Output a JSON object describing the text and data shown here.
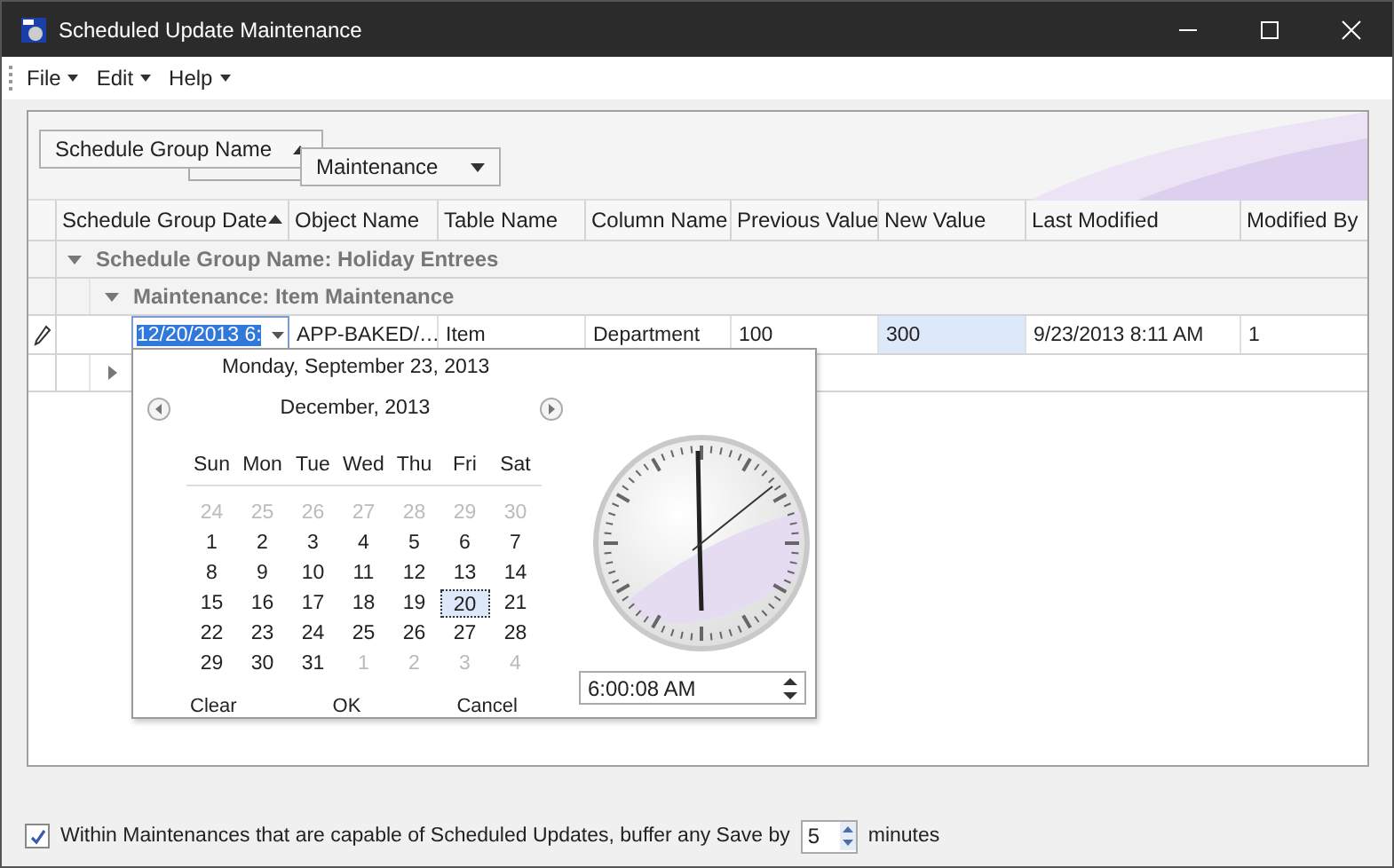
{
  "window": {
    "title": "Scheduled Update Maintenance"
  },
  "menu": [
    {
      "label": "File"
    },
    {
      "label": "Edit"
    },
    {
      "label": "Help"
    }
  ],
  "group_panel": [
    {
      "label": "Schedule Group Name",
      "ascending": true
    },
    {
      "label": "Maintenance",
      "ascending": false
    }
  ],
  "columns": [
    {
      "label": "Schedule Group Date",
      "sorted": true
    },
    {
      "label": "Object Name",
      "sorted": false
    },
    {
      "label": "Table Name",
      "sorted": false
    },
    {
      "label": "Column Name",
      "sorted": false
    },
    {
      "label": "Previous Value",
      "sorted": false
    },
    {
      "label": "New Value",
      "sorted": false
    },
    {
      "label": "Last Modified",
      "sorted": false
    },
    {
      "label": "Modified By",
      "sorted": false
    }
  ],
  "rows": [
    {
      "kind": "group",
      "text": "Schedule Group Name: Holiday Entrees",
      "expanded": true
    },
    {
      "kind": "subgroup",
      "text": "Maintenance: Item Maintenance",
      "expanded": true
    },
    {
      "kind": "data",
      "editing": true,
      "cells": [
        {
          "text": "12/20/2013 6:",
          "selected": false
        },
        {
          "text": "APP-BAKED/…",
          "selected": false
        },
        {
          "text": "Item",
          "selected": false
        },
        {
          "text": "Department",
          "selected": false
        },
        {
          "text": "100",
          "selected": false
        },
        {
          "text": "300",
          "selected": true
        },
        {
          "text": "9/23/2013 8:11 AM",
          "selected": false
        },
        {
          "text": "1",
          "selected": false
        }
      ]
    },
    {
      "kind": "subgroup_collapsed",
      "text": "",
      "expanded": false
    }
  ],
  "calendar": {
    "today": "Monday, September 23, 2013",
    "month": "December, 2013",
    "weekdays": [
      "Sun",
      "Mon",
      "Tue",
      "Wed",
      "Thu",
      "Fri",
      "Sat"
    ],
    "weeks": [
      [
        {
          "text": "24",
          "other_month": true,
          "selected": false
        },
        {
          "text": "25",
          "other_month": true,
          "selected": false
        },
        {
          "text": "26",
          "other_month": true,
          "selected": false
        },
        {
          "text": "27",
          "other_month": true,
          "selected": false
        },
        {
          "text": "28",
          "other_month": true,
          "selected": false
        },
        {
          "text": "29",
          "other_month": true,
          "selected": false
        },
        {
          "text": "30",
          "other_month": true,
          "selected": false
        }
      ],
      [
        {
          "text": "1",
          "other_month": false,
          "selected": false
        },
        {
          "text": "2",
          "other_month": false,
          "selected": false
        },
        {
          "text": "3",
          "other_month": false,
          "selected": false
        },
        {
          "text": "4",
          "other_month": false,
          "selected": false
        },
        {
          "text": "5",
          "other_month": false,
          "selected": false
        },
        {
          "text": "6",
          "other_month": false,
          "selected": false
        },
        {
          "text": "7",
          "other_month": false,
          "selected": false
        }
      ],
      [
        {
          "text": "8",
          "other_month": false,
          "selected": false
        },
        {
          "text": "9",
          "other_month": false,
          "selected": false
        },
        {
          "text": "10",
          "other_month": false,
          "selected": false
        },
        {
          "text": "11",
          "other_month": false,
          "selected": false
        },
        {
          "text": "12",
          "other_month": false,
          "selected": false
        },
        {
          "text": "13",
          "other_month": false,
          "selected": false
        },
        {
          "text": "14",
          "other_month": false,
          "selected": false
        }
      ],
      [
        {
          "text": "15",
          "other_month": false,
          "selected": false
        },
        {
          "text": "16",
          "other_month": false,
          "selected": false
        },
        {
          "text": "17",
          "other_month": false,
          "selected": false
        },
        {
          "text": "18",
          "other_month": false,
          "selected": false
        },
        {
          "text": "19",
          "other_month": false,
          "selected": false
        },
        {
          "text": "20",
          "other_month": false,
          "selected": true
        },
        {
          "text": "21",
          "other_month": false,
          "selected": false
        }
      ],
      [
        {
          "text": "22",
          "other_month": false,
          "selected": false
        },
        {
          "text": "23",
          "other_month": false,
          "selected": false
        },
        {
          "text": "24",
          "other_month": false,
          "selected": false
        },
        {
          "text": "25",
          "other_month": false,
          "selected": false
        },
        {
          "text": "26",
          "other_month": false,
          "selected": false
        },
        {
          "text": "27",
          "other_month": false,
          "selected": false
        },
        {
          "text": "28",
          "other_month": false,
          "selected": false
        }
      ],
      [
        {
          "text": "29",
          "other_month": false,
          "selected": false
        },
        {
          "text": "30",
          "other_month": false,
          "selected": false
        },
        {
          "text": "31",
          "other_month": false,
          "selected": false
        },
        {
          "text": "1",
          "other_month": true,
          "selected": false
        },
        {
          "text": "2",
          "other_month": true,
          "selected": false
        },
        {
          "text": "3",
          "other_month": true,
          "selected": false
        },
        {
          "text": "4",
          "other_month": true,
          "selected": false
        }
      ]
    ],
    "buttons": [
      "Clear",
      "OK",
      "Cancel"
    ],
    "time": "6:00:08 AM"
  },
  "footer": {
    "checked": true,
    "label": "Within Maintenances that are capable of Scheduled Updates, buffer any Save by",
    "buffer": "5",
    "unit": "minutes"
  }
}
